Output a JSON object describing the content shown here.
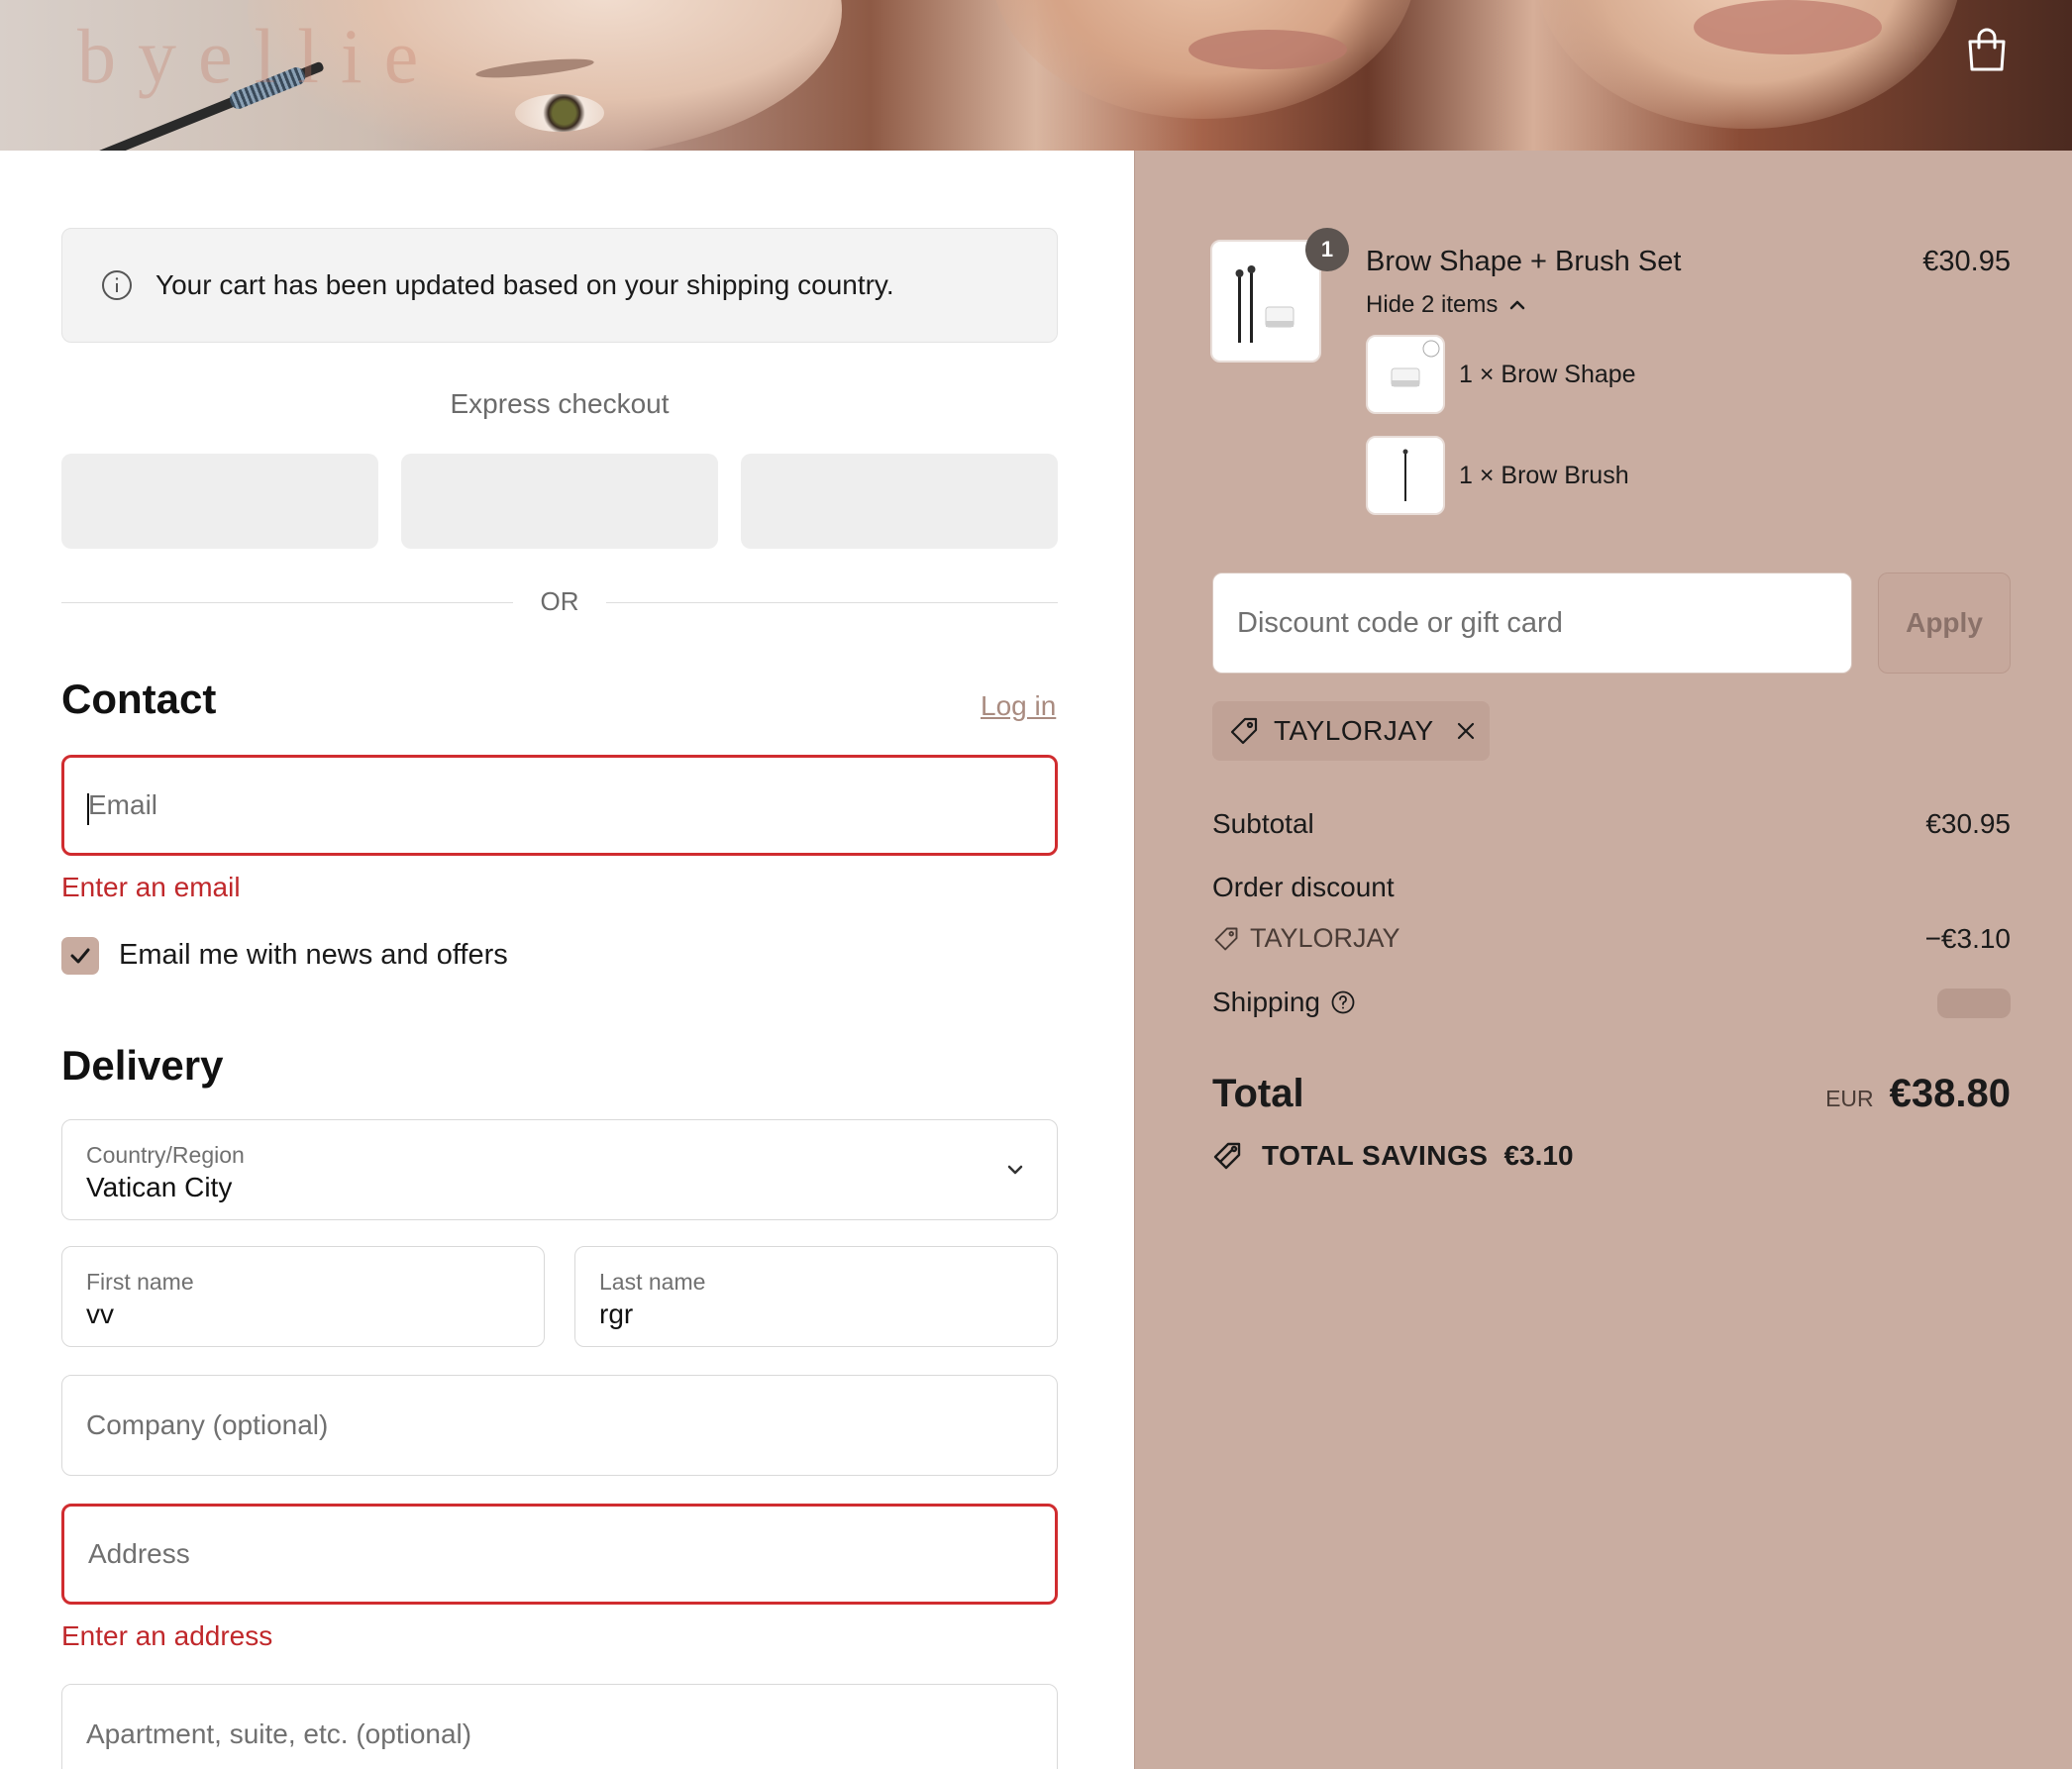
{
  "header": {
    "logo_text": "byellie"
  },
  "notice": {
    "text": "Your cart has been updated based on your shipping country."
  },
  "express": {
    "title": "Express checkout",
    "or": "OR"
  },
  "contact": {
    "heading": "Contact",
    "login": "Log in",
    "email_placeholder": "Email",
    "email_error": "Enter an email",
    "newsletter_label": "Email me with news and offers",
    "newsletter_checked": true
  },
  "delivery": {
    "heading": "Delivery",
    "country_label": "Country/Region",
    "country_value": "Vatican City",
    "first_name_label": "First name",
    "first_name_value": "vv",
    "last_name_label": "Last name",
    "last_name_value": "rgr",
    "company_placeholder": "Company (optional)",
    "address_placeholder": "Address",
    "address_error": "Enter an address",
    "apartment_placeholder": "Apartment, suite, etc. (optional)"
  },
  "summary": {
    "product": {
      "quantity_badge": "1",
      "name": "Brow Shape + Brush Set",
      "price": "€30.95",
      "toggle": "Hide 2 items",
      "items": [
        {
          "label": "1 × Brow Shape"
        },
        {
          "label": "1 × Brow Brush"
        }
      ]
    },
    "discount_placeholder": "Discount code or gift card",
    "apply_label": "Apply",
    "applied_code": "TAYLORJAY",
    "subtotal_label": "Subtotal",
    "subtotal_value": "€30.95",
    "order_discount_label": "Order discount",
    "order_discount_code": "TAYLORJAY",
    "order_discount_value": "−€3.10",
    "shipping_label": "Shipping",
    "total_label": "Total",
    "currency": "EUR",
    "total_value": "€38.80",
    "savings_label": "TOTAL SAVINGS",
    "savings_value": "€3.10"
  },
  "colors": {
    "accent": "#c9ada1",
    "error": "#d02c2f",
    "link": "#a98b80"
  },
  "icons": [
    "shopping-bag-icon",
    "info-icon",
    "checkmark-icon",
    "chevron-down-icon",
    "chevron-up-icon",
    "tag-icon",
    "close-icon",
    "question-circle-icon",
    "savings-tag-icon"
  ]
}
